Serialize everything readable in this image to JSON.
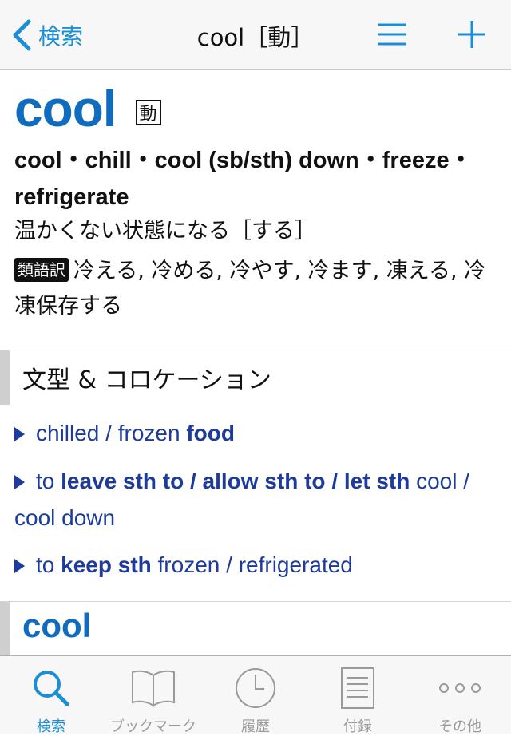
{
  "colors": {
    "accent": "#1a8fd8",
    "headword": "#0f6cbf",
    "collocation": "#1c3b9a",
    "inactive": "#9a9a9a"
  },
  "nav": {
    "back_label": "検索",
    "title": "cool［動］",
    "icons": [
      "chevron-left-icon",
      "menu-icon",
      "plus-icon"
    ]
  },
  "entry": {
    "headword": "cool",
    "pos": "動",
    "synonyms": "cool・chill・cool (sb/sth) down・freeze・refrigerate",
    "sense": "温かくない状態になる［する］",
    "translation_badge": "類語訳",
    "translation": "冷える, 冷める, 冷やす, 冷ます, 凍える, 冷凍保存する"
  },
  "section": {
    "title": "文型 & コロケーション",
    "items": [
      [
        {
          "t": "chilled / frozen ",
          "b": false
        },
        {
          "t": "food",
          "b": true
        }
      ],
      [
        {
          "t": "to ",
          "b": false
        },
        {
          "t": "leave sth to / allow sth to / let sth",
          "b": true
        },
        {
          "t": " cool / cool down",
          "b": false
        }
      ],
      [
        {
          "t": "to ",
          "b": false
        },
        {
          "t": "keep sth",
          "b": true
        },
        {
          "t": " frozen / refrigerated",
          "b": false
        }
      ]
    ]
  },
  "section2": {
    "headword": "cool"
  },
  "tabs": [
    {
      "label": "検索",
      "icon": "search-icon",
      "active": true
    },
    {
      "label": "ブックマーク",
      "icon": "book-icon",
      "active": false
    },
    {
      "label": "履歴",
      "icon": "clock-icon",
      "active": false
    },
    {
      "label": "付録",
      "icon": "document-icon",
      "active": false
    },
    {
      "label": "その他",
      "icon": "more-icon",
      "active": false
    }
  ]
}
